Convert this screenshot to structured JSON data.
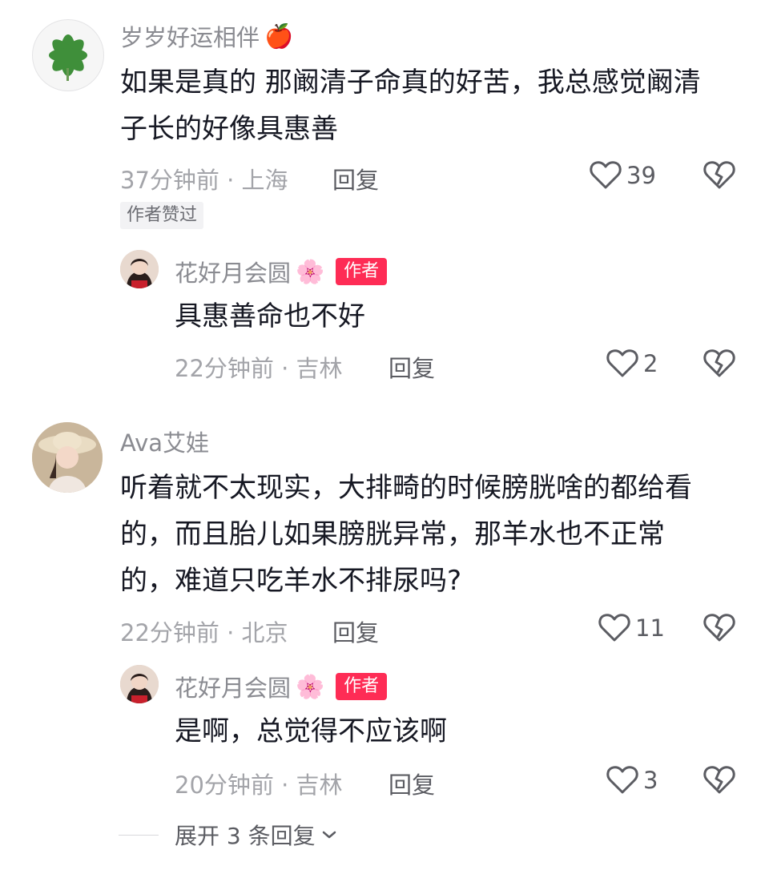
{
  "comments": [
    {
      "username": "岁岁好运相伴",
      "username_emoji": "🍎",
      "text_lines": [
        "如果是真的 那阚清子命真的好苦，我总感觉阚清",
        "子长的好像具惠善"
      ],
      "time_location": "37分钟前 · 上海",
      "reply_label": "回复",
      "likes": "39",
      "tag": "作者赞过",
      "reply": {
        "username": "花好月会圆",
        "username_emoji": "🌸",
        "badge": "作者",
        "text": "具惠善命也不好",
        "time_location": "22分钟前 · 吉林",
        "reply_label": "回复",
        "likes": "2"
      }
    },
    {
      "username": "Ava艾娃",
      "text_lines": [
        "听着就不太现实，大排畸的时候膀胱啥的都给看",
        "的，而且胎儿如果膀胱异常，那羊水也不正常",
        "的，难道只吃羊水不排尿吗?"
      ],
      "time_location": "22分钟前 · 北京",
      "reply_label": "回复",
      "likes": "11",
      "reply": {
        "username": "花好月会圆",
        "username_emoji": "🌸",
        "badge": "作者",
        "text": "是啊，总觉得不应该啊",
        "time_location": "20分钟前 · 吉林",
        "reply_label": "回复",
        "likes": "3"
      },
      "expand_label": "展开 3 条回复"
    }
  ]
}
